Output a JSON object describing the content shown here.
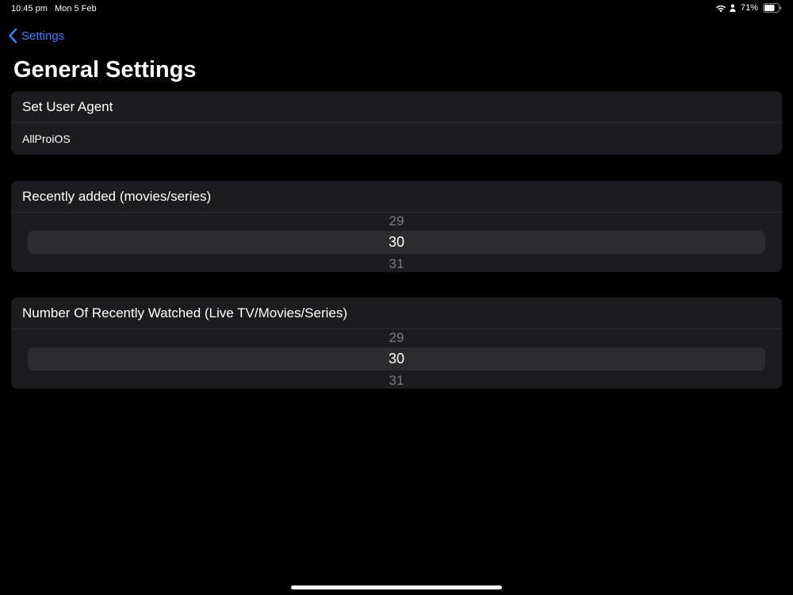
{
  "status_bar": {
    "time": "10:45 pm",
    "date": "Mon 5 Feb",
    "battery": "71%",
    "icons": [
      "wifi-icon",
      "person-icon",
      "battery-icon"
    ]
  },
  "nav": {
    "back_label": "Settings",
    "title": "General Settings"
  },
  "user_agent": {
    "label": "Set User Agent",
    "value": "AllProiOS"
  },
  "recently_added": {
    "label": "Recently added (movies/series)",
    "picker": {
      "prev": "29",
      "selected": "30",
      "next": "31"
    }
  },
  "recently_watched": {
    "label": "Number Of Recently Watched (Live TV/Movies/Series)",
    "picker": {
      "prev": "29",
      "selected": "30",
      "next": "31"
    }
  },
  "colors": {
    "accent": "#3b82f6",
    "background": "#000000",
    "group": "#1c1c1e"
  }
}
